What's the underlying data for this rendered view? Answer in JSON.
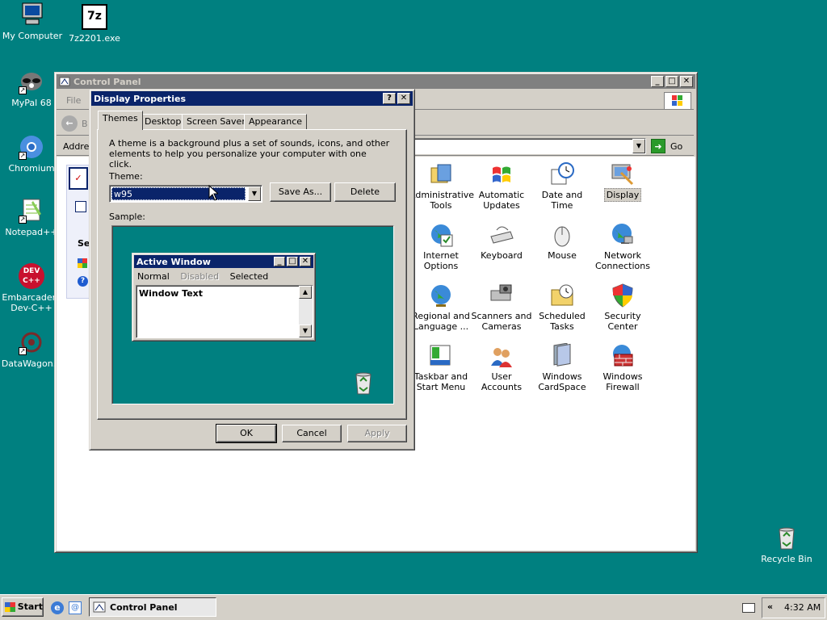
{
  "desktop": {
    "icons": [
      {
        "label": "My Computer"
      },
      {
        "label": "7z2201.exe",
        "glyph": "7z"
      },
      {
        "label": "MyPal 68"
      },
      {
        "label": "Chromium"
      },
      {
        "label": "Notepad++"
      },
      {
        "label": "Embarcadero Dev-C++",
        "glyph": "DEV C++"
      },
      {
        "label": "DataWagon..."
      },
      {
        "label": "Recycle Bin"
      }
    ]
  },
  "control_panel": {
    "title": "Control Panel",
    "menu_file": "File",
    "address_label": "Addres",
    "go_label": "Go",
    "back_label": "B",
    "side_label": "Se",
    "items": [
      {
        "label": "Administrative Tools",
        "icon": "admin-tools-icon"
      },
      {
        "label": "Automatic Updates",
        "icon": "windows-logo-icon"
      },
      {
        "label": "Date and Time",
        "icon": "calendar-clock-icon"
      },
      {
        "label": "Display",
        "icon": "display-icon"
      },
      {
        "label": "Internet Options",
        "icon": "globe-icon"
      },
      {
        "label": "Keyboard",
        "icon": "keyboard-icon"
      },
      {
        "label": "Mouse",
        "icon": "mouse-icon"
      },
      {
        "label": "Network Connections",
        "icon": "network-globe-icon"
      },
      {
        "label": "Regional and Language ...",
        "icon": "regional-globe-icon"
      },
      {
        "label": "Scanners and Cameras",
        "icon": "scanner-icon"
      },
      {
        "label": "Scheduled Tasks",
        "icon": "folder-clock-icon"
      },
      {
        "label": "Security Center",
        "icon": "shield-icon"
      },
      {
        "label": "Taskbar and Start Menu",
        "icon": "taskbar-icon"
      },
      {
        "label": "User Accounts",
        "icon": "users-icon"
      },
      {
        "label": "Windows CardSpace",
        "icon": "cardspace-icon"
      },
      {
        "label": "Windows Firewall",
        "icon": "firewall-icon"
      }
    ]
  },
  "display_properties": {
    "title": "Display Properties",
    "help_glyph": "?",
    "close_glyph": "✕",
    "tabs": [
      "Themes",
      "Desktop",
      "Screen Saver",
      "Appearance"
    ],
    "description": "A theme is a background plus a set of sounds, icons, and other elements to help you personalize your computer with one click.",
    "theme_label": "Theme:",
    "theme_value": "w95",
    "save_as": "Save As...",
    "delete": "Delete",
    "sample_label": "Sample:",
    "sample_window": {
      "title": "Active Window",
      "menu": [
        "Normal",
        "Disabled",
        "Selected"
      ],
      "text": "Window Text"
    },
    "ok": "OK",
    "cancel": "Cancel",
    "apply": "Apply"
  },
  "taskbar": {
    "start": "Start",
    "task": "Control Panel",
    "chevron": "«",
    "clock": "4:32 AM"
  },
  "colors": {
    "desktop": "#008080",
    "active_title": "#0a246a",
    "inactive_title": "#808080",
    "face": "#d4d0c8"
  }
}
